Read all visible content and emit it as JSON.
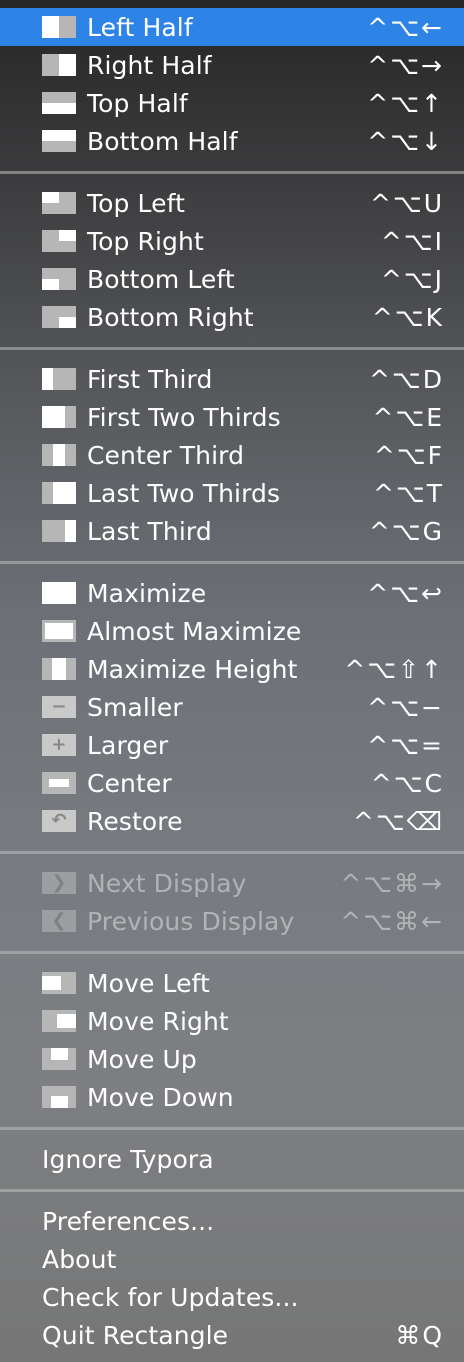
{
  "menu": {
    "groups": [
      {
        "items": [
          {
            "label": "Left Half",
            "shortcut": "^⌥←",
            "icon": "left-half-icon",
            "selected": true
          },
          {
            "label": "Right Half",
            "shortcut": "^⌥→",
            "icon": "right-half-icon"
          },
          {
            "label": "Top Half",
            "shortcut": "^⌥↑",
            "icon": "top-half-icon"
          },
          {
            "label": "Bottom Half",
            "shortcut": "^⌥↓",
            "icon": "bottom-half-icon"
          }
        ]
      },
      {
        "items": [
          {
            "label": "Top Left",
            "shortcut": "^⌥U",
            "icon": "top-left-icon"
          },
          {
            "label": "Top Right",
            "shortcut": "^⌥I",
            "icon": "top-right-icon"
          },
          {
            "label": "Bottom Left",
            "shortcut": "^⌥J",
            "icon": "bottom-left-icon"
          },
          {
            "label": "Bottom Right",
            "shortcut": "^⌥K",
            "icon": "bottom-right-icon"
          }
        ]
      },
      {
        "items": [
          {
            "label": "First Third",
            "shortcut": "^⌥D",
            "icon": "first-third-icon"
          },
          {
            "label": "First Two Thirds",
            "shortcut": "^⌥E",
            "icon": "first-two-thirds-icon"
          },
          {
            "label": "Center Third",
            "shortcut": "^⌥F",
            "icon": "center-third-icon"
          },
          {
            "label": "Last Two Thirds",
            "shortcut": "^⌥T",
            "icon": "last-two-thirds-icon"
          },
          {
            "label": "Last Third",
            "shortcut": "^⌥G",
            "icon": "last-third-icon"
          }
        ]
      },
      {
        "items": [
          {
            "label": "Maximize",
            "shortcut": "^⌥↩",
            "icon": "maximize-icon"
          },
          {
            "label": "Almost Maximize",
            "shortcut": "",
            "icon": "almost-maximize-icon"
          },
          {
            "label": "Maximize Height",
            "shortcut": "^⌥⇧↑",
            "icon": "maximize-height-icon"
          },
          {
            "label": "Smaller",
            "shortcut": "^⌥−",
            "icon": "smaller-icon"
          },
          {
            "label": "Larger",
            "shortcut": "^⌥=",
            "icon": "larger-icon"
          },
          {
            "label": "Center",
            "shortcut": "^⌥C",
            "icon": "center-icon"
          },
          {
            "label": "Restore",
            "shortcut": "^⌥⌫",
            "icon": "restore-icon"
          }
        ]
      },
      {
        "items": [
          {
            "label": "Next Display",
            "shortcut": "^⌥⌘→",
            "icon": "next-display-icon",
            "disabled": true
          },
          {
            "label": "Previous Display",
            "shortcut": "^⌥⌘←",
            "icon": "previous-display-icon",
            "disabled": true
          }
        ]
      },
      {
        "items": [
          {
            "label": "Move Left",
            "shortcut": "",
            "icon": "move-left-icon"
          },
          {
            "label": "Move Right",
            "shortcut": "",
            "icon": "move-right-icon"
          },
          {
            "label": "Move Up",
            "shortcut": "",
            "icon": "move-up-icon"
          },
          {
            "label": "Move Down",
            "shortcut": "",
            "icon": "move-down-icon"
          }
        ]
      },
      {
        "items": [
          {
            "label": "Ignore Typora",
            "shortcut": "",
            "icon": ""
          }
        ]
      },
      {
        "items": [
          {
            "label": "Preferences...",
            "shortcut": "",
            "icon": ""
          },
          {
            "label": "About",
            "shortcut": "",
            "icon": ""
          },
          {
            "label": "Check for Updates...",
            "shortcut": "",
            "icon": ""
          },
          {
            "label": "Quit Rectangle",
            "shortcut": "⌘Q",
            "icon": ""
          }
        ]
      }
    ]
  }
}
